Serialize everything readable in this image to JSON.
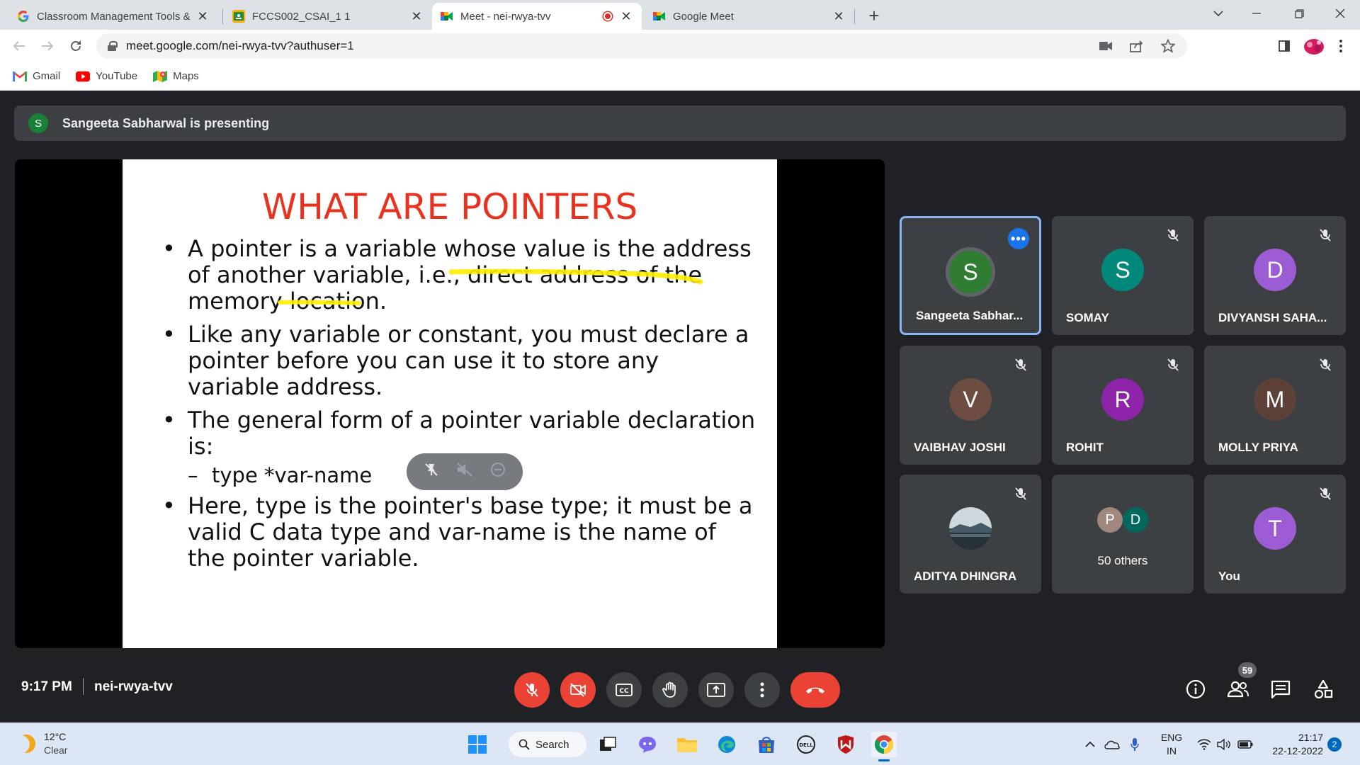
{
  "browser": {
    "tabs": [
      {
        "title": "Classroom Management Tools &",
        "icon": "google-g-icon",
        "active": false
      },
      {
        "title": "FCCS002_CSAI_1 1",
        "icon": "classroom-icon",
        "active": false
      },
      {
        "title": "Meet - nei-rwya-tvv",
        "icon": "meet-icon",
        "active": true,
        "recording": true
      },
      {
        "title": "Google Meet",
        "icon": "meet-icon",
        "active": false
      }
    ],
    "url": "meet.google.com/nei-rwya-tvv?authuser=1",
    "bookmarks": [
      {
        "label": "Gmail",
        "icon": "gmail-icon"
      },
      {
        "label": "YouTube",
        "icon": "youtube-icon"
      },
      {
        "label": "Maps",
        "icon": "maps-icon"
      }
    ]
  },
  "meet": {
    "presenter_initial": "S",
    "presenting_text": "Sangeeta Sabharwal is presenting",
    "slide": {
      "title": "WHAT ARE POINTERS",
      "bullets": [
        "A pointer is a variable whose value is the address of another variable, i.e., direct address of the memory location.",
        " Like any variable or constant, you must declare a pointer before you can use it to store any variable address.",
        "The general form of a pointer variable declaration is:",
        "type  *var-name",
        "Here, type is the pointer's base type; it must be a valid C data type and var-name is the name of the pointer variable."
      ]
    },
    "participants": [
      {
        "initial": "S",
        "name": "Sangeeta Sabhar...",
        "color": "#2e7d32",
        "active": true
      },
      {
        "initial": "S",
        "name": "SOMAY",
        "color": "#00897b"
      },
      {
        "initial": "D",
        "name": "DIVYANSH SAHA...",
        "color": "#9c5cd4"
      },
      {
        "initial": "V",
        "name": "VAIBHAV JOSHI",
        "color": "#6d4c41"
      },
      {
        "initial": "R",
        "name": "ROHIT",
        "color": "#8e24aa"
      },
      {
        "initial": "M",
        "name": "MOLLY PRIYA",
        "color": "#5d4037"
      },
      {
        "initial": "",
        "name": "ADITYA DHINGRA",
        "color": "#607d8b"
      },
      {
        "initial": "",
        "name": "",
        "color": ""
      },
      {
        "initial": "T",
        "name": "You",
        "color": "#9c5cd4"
      }
    ],
    "others": {
      "label": "50 others",
      "avatars": [
        {
          "initial": "P",
          "color": "#a1887f"
        },
        {
          "initial": "D",
          "color": "#00695c"
        }
      ]
    },
    "time": "9:17 PM",
    "meeting_code": "nei-rwya-tvv",
    "people_count": "59"
  },
  "taskbar": {
    "temperature": "12°C",
    "condition": "Clear",
    "search_label": "Search",
    "language": "ENG",
    "region": "IN",
    "time": "21:17",
    "date": "22-12-2022",
    "notifications": "2"
  }
}
